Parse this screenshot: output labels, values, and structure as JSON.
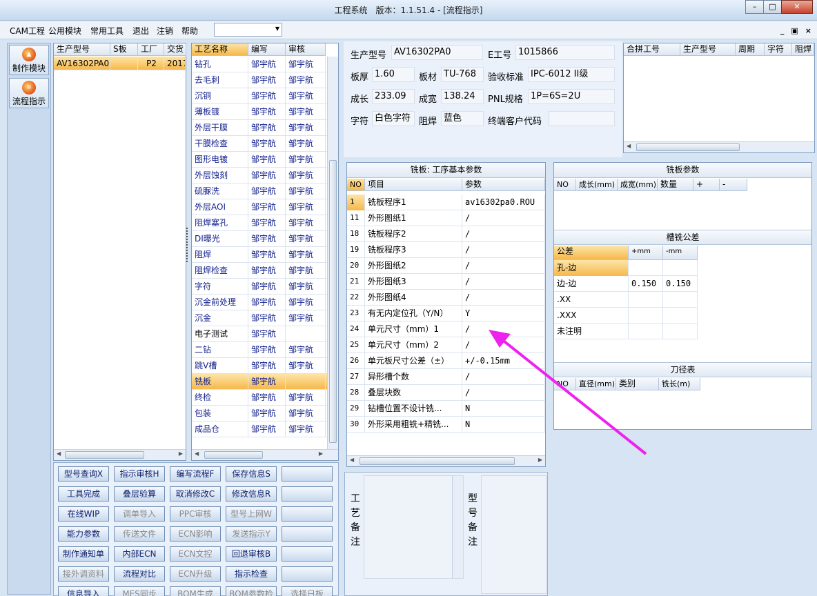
{
  "window": {
    "title": "工程系统　版本：1.1.51.4 - [流程指示]"
  },
  "menu": [
    "CAM工程",
    "公用模块",
    "常用工具",
    "退出",
    "注销",
    "帮助"
  ],
  "mdi": [
    "_",
    "▣",
    "×"
  ],
  "sidebar": [
    {
      "label": "制作模块"
    },
    {
      "label": "流程指示"
    }
  ],
  "model_grid": {
    "headers": [
      "生产型号",
      "S板",
      "工厂",
      "交货"
    ],
    "rows": [
      [
        "AV16302PA0",
        "",
        "P2",
        "2017"
      ]
    ]
  },
  "process_grid": {
    "headers": [
      "工艺名称",
      "编写",
      "审核"
    ],
    "rows": [
      [
        "钻孔",
        "邹宇航",
        "邹宇航"
      ],
      [
        "去毛刺",
        "邹宇航",
        "邹宇航"
      ],
      [
        "沉铜",
        "邹宇航",
        "邹宇航"
      ],
      [
        "薄板镀",
        "邹宇航",
        "邹宇航"
      ],
      [
        "外层干膜",
        "邹宇航",
        "邹宇航"
      ],
      [
        "干膜检查",
        "邹宇航",
        "邹宇航"
      ],
      [
        "图形电镀",
        "邹宇航",
        "邹宇航"
      ],
      [
        "外层蚀刻",
        "邹宇航",
        "邹宇航"
      ],
      [
        "硫脲洗",
        "邹宇航",
        "邹宇航"
      ],
      [
        "外层AOI",
        "邹宇航",
        "邹宇航"
      ],
      [
        "阻焊塞孔",
        "邹宇航",
        "邹宇航"
      ],
      [
        "DI曝光",
        "邹宇航",
        "邹宇航"
      ],
      [
        "阻焊",
        "邹宇航",
        "邹宇航"
      ],
      [
        "阻焊检查",
        "邹宇航",
        "邹宇航"
      ],
      [
        "字符",
        "邹宇航",
        "邹宇航"
      ],
      [
        "沉金前处理",
        "邹宇航",
        "邹宇航"
      ],
      [
        "沉金",
        "邹宇航",
        "邹宇航"
      ],
      [
        "电子测试",
        "邹宇航",
        ""
      ],
      [
        "二钻",
        "邹宇航",
        "邹宇航"
      ],
      [
        "跳V槽",
        "邹宇航",
        "邹宇航"
      ],
      [
        "铣板",
        "邹宇航",
        ""
      ],
      [
        "终检",
        "邹宇航",
        "邹宇航"
      ],
      [
        "包装",
        "邹宇航",
        "邹宇航"
      ],
      [
        "成品仓",
        "邹宇航",
        "邹宇航"
      ]
    ]
  },
  "buttons": [
    [
      "型号查询X",
      "指示审核H",
      "编写流程F",
      "保存信息S",
      ""
    ],
    [
      "工具完成",
      "叠层验算",
      "取消修改C",
      "修改信息R",
      ""
    ],
    [
      "在线WIP",
      "调单导入",
      "PPC审核",
      "型号上网W",
      ""
    ],
    [
      "能力参数",
      "传送文件",
      "ECN影响",
      "发送指示Y",
      ""
    ],
    [
      "制作通知单",
      "内部ECN",
      "ECN文控",
      "回退审核B",
      ""
    ],
    [
      "接外调资料",
      "流程对比",
      "ECN升级",
      "指示检查",
      ""
    ],
    [
      "信息导入",
      "MES同步",
      "BOM生成",
      "BOM参数检查",
      "选择日板"
    ]
  ],
  "info": {
    "model_label": "生产型号",
    "model": "AV16302PA0",
    "eno_label": "E工号",
    "eno": "1015866",
    "thick_label": "板厚",
    "thick": "1.60",
    "mat_label": "板材",
    "mat": "TU-768",
    "std_label": "验收标准",
    "std": "IPC-6012 II级",
    "len_label": "成长",
    "len": "233.09",
    "wid_label": "成宽",
    "wid": "138.24",
    "pnl_label": "PNL规格",
    "pnl": "1P=6S=2U",
    "char_label": "字符",
    "char": "白色字符",
    "mask_label": "阻焊",
    "mask": "蓝色",
    "cust_label": "终端客户代码",
    "cust": ""
  },
  "merge_grid": {
    "headers": [
      "合拼工号",
      "生产型号",
      "周期",
      "字符",
      "阻焊"
    ]
  },
  "milling": {
    "title": "铣板: 工序基本参数",
    "headers": [
      "NO",
      "项目",
      "参数"
    ],
    "rows": [
      [
        "1",
        "铣板程序1",
        "av16302pa0.ROU"
      ],
      [
        "11",
        "外形图纸1",
        "/"
      ],
      [
        "18",
        "铣板程序2",
        "/"
      ],
      [
        "19",
        "铣板程序3",
        "/"
      ],
      [
        "20",
        "外形图纸2",
        "/"
      ],
      [
        "21",
        "外形图纸3",
        "/"
      ],
      [
        "22",
        "外形图纸4",
        "/"
      ],
      [
        "23",
        "有无内定位孔（Y/N）",
        "Y"
      ],
      [
        "24",
        "单元尺寸（mm）1",
        "/"
      ],
      [
        "25",
        "单元尺寸（mm）2",
        "/"
      ],
      [
        "26",
        "单元板尺寸公差（±）",
        "+/-0.15mm"
      ],
      [
        "27",
        "异形槽个数",
        "/"
      ],
      [
        "28",
        "叠层块数",
        "/"
      ],
      [
        "29",
        "钻槽位置不设计铣...",
        "N"
      ],
      [
        "30",
        "外形采用粗铣+精铣...",
        "N"
      ]
    ]
  },
  "mill_params": {
    "title": "铣板参数",
    "headers": [
      "NO",
      "成长(mm)",
      "成宽(mm)",
      "数量",
      "+",
      "-"
    ]
  },
  "tolerance": {
    "title": "槽铣公差",
    "headers": [
      "公差",
      "+mm",
      "-mm"
    ],
    "rows": [
      [
        "孔-边",
        "",
        ""
      ],
      [
        "边-边",
        "0.150",
        "0.150"
      ],
      [
        ".XX",
        "",
        ""
      ],
      [
        ".XXX",
        "",
        ""
      ],
      [
        "未注明",
        "",
        ""
      ]
    ]
  },
  "tools": {
    "title": "刀径表",
    "headers": [
      "NO",
      "直径(mm)",
      "类别",
      "铣长(m)"
    ]
  },
  "notes": {
    "process_label": [
      "工",
      "艺",
      "备",
      "注"
    ],
    "model_label": [
      "型",
      "号",
      "备",
      "注"
    ]
  }
}
